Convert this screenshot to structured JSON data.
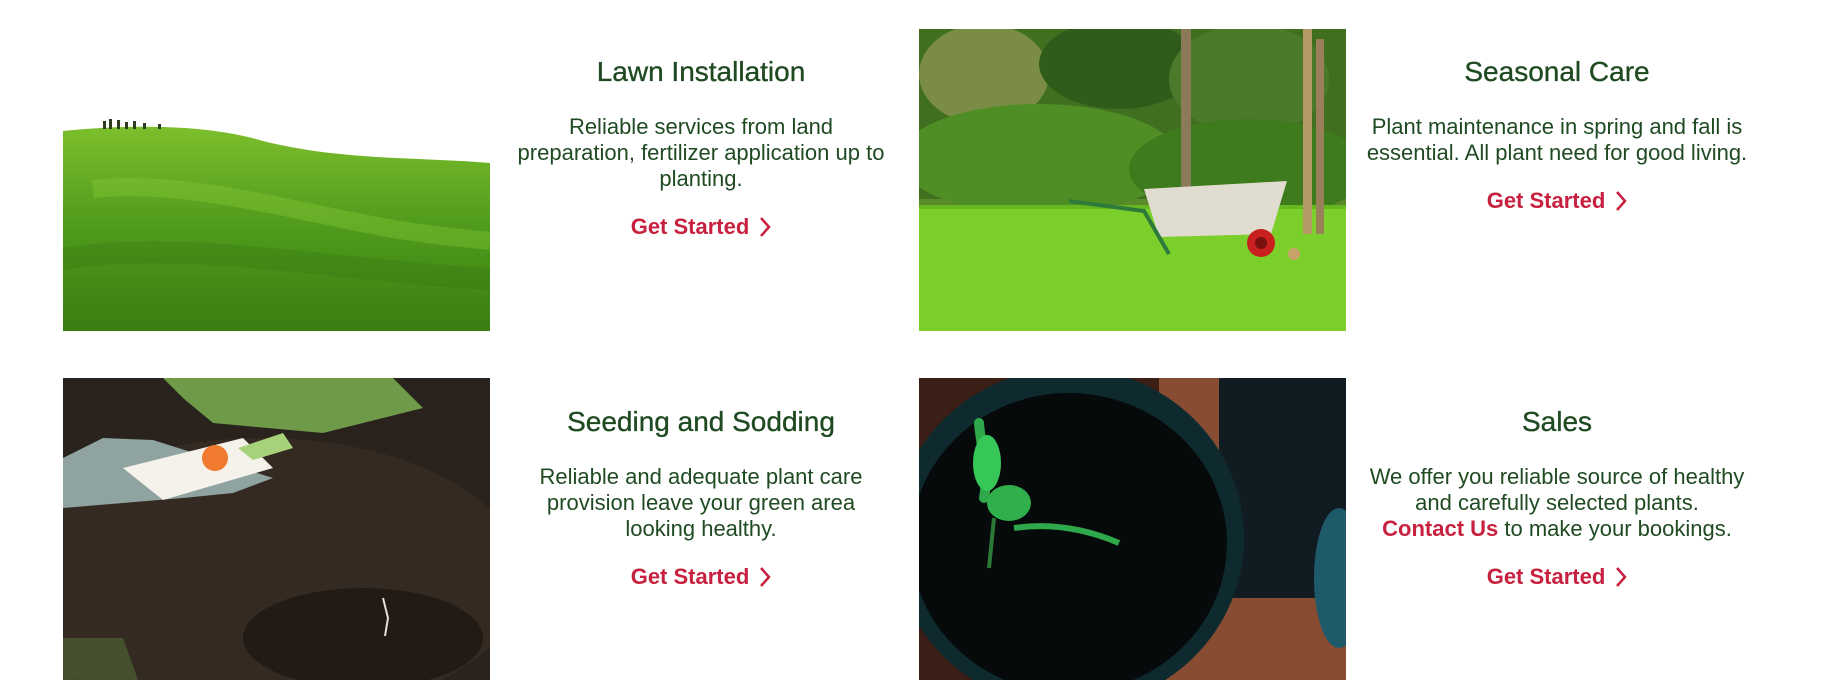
{
  "services": [
    {
      "title": "Lawn Installation",
      "description": "Reliable services from land preparation, fertilizer application up to planting.",
      "cta_label": "Get Started",
      "image_alt": "green grassy hill"
    },
    {
      "title": "Seasonal Care",
      "description": "Plant maintenance in spring and fall is essential. All plant need for good living.",
      "cta_label": "Get Started",
      "image_alt": "wheelbarrow on lawn"
    },
    {
      "title": "Seeding and Sodding",
      "description": "Reliable and adequate plant care provision leave your green area looking healthy.",
      "cta_label": "Get Started",
      "image_alt": "gloved hands planting seeds in soil"
    },
    {
      "title": "Sales",
      "description_prefix": "We offer you reliable source of healthy and carefully selected plants.",
      "contact_link": "Contact Us",
      "description_suffix": " to make your bookings.",
      "cta_label": "Get Started",
      "image_alt": "seedling in black pot"
    }
  ],
  "colors": {
    "heading": "#1f4a22",
    "accent": "#c8213f"
  },
  "icons": {
    "cta": "chevron-right-icon"
  }
}
